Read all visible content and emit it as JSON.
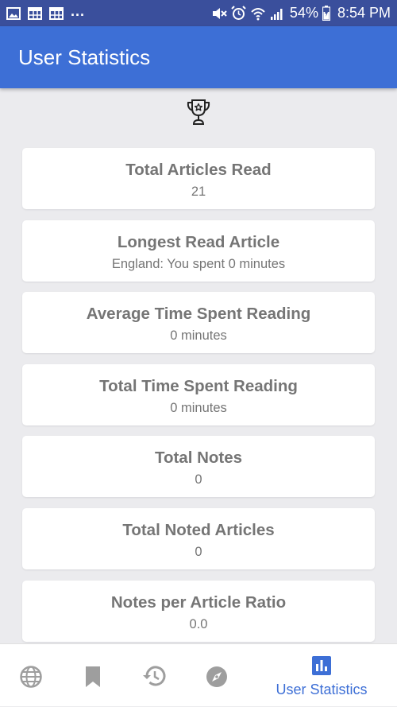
{
  "status_bar": {
    "overflow_dots": "...",
    "battery_percent": "54%",
    "time": "8:54 PM",
    "left_icons": [
      "image-icon",
      "calendar-icon",
      "calendar-icon"
    ],
    "right_icons": [
      "mute-icon",
      "alarm-icon",
      "wifi-icon",
      "signal-icon",
      "battery-icon"
    ]
  },
  "app_bar": {
    "title": "User Statistics",
    "color": "#3d6fd6"
  },
  "header_icon": "trophy-icon",
  "stats": [
    {
      "title": "Total Articles Read",
      "value": "21"
    },
    {
      "title": "Longest Read Article",
      "value": "England: You spent 0 minutes"
    },
    {
      "title": "Average Time Spent Reading",
      "value": "0 minutes"
    },
    {
      "title": "Total Time Spent Reading",
      "value": "0 minutes"
    },
    {
      "title": "Total Notes",
      "value": "0"
    },
    {
      "title": "Total Noted Articles",
      "value": "0"
    },
    {
      "title": "Notes per Article Ratio",
      "value": "0.0"
    }
  ],
  "bottom_nav": {
    "items": [
      {
        "icon": "globe-icon"
      },
      {
        "icon": "bookmark-icon"
      },
      {
        "icon": "history-icon"
      },
      {
        "icon": "compass-icon"
      },
      {
        "icon": "bar-chart-icon",
        "label": "User Statistics",
        "active": true
      }
    ],
    "active_color": "#3d6fd6",
    "inactive_color": "#9e9e9e"
  }
}
